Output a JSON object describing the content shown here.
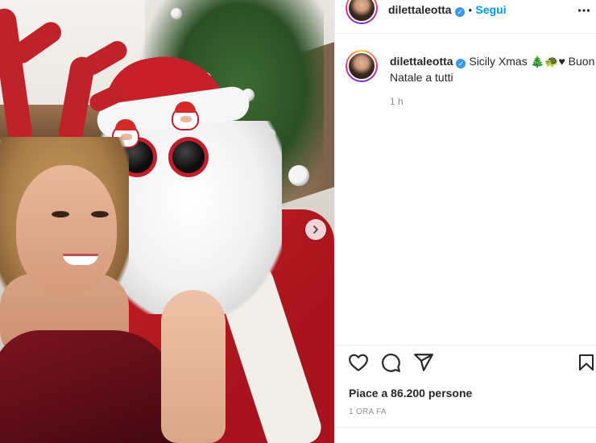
{
  "post": {
    "username": "dilettaleotta",
    "follow_label": "Segui",
    "separator": "•",
    "more_label": "•••",
    "caption_text": "Sicily Xmas 🎄🐢♥ Buon Natale a tutti",
    "caption_time": "1 h",
    "likes": "Piace a 86.200 persone",
    "date": "1 ORA FA"
  },
  "icons": {
    "verified": "verified-badge-icon",
    "like": "heart-icon",
    "comment": "comment-icon",
    "share": "share-icon",
    "save": "bookmark-icon",
    "next": "chevron-right-icon"
  },
  "colors": {
    "link": "#0095f6",
    "verified": "#3897f0",
    "muted": "#8e8e8e",
    "text": "#262626"
  }
}
